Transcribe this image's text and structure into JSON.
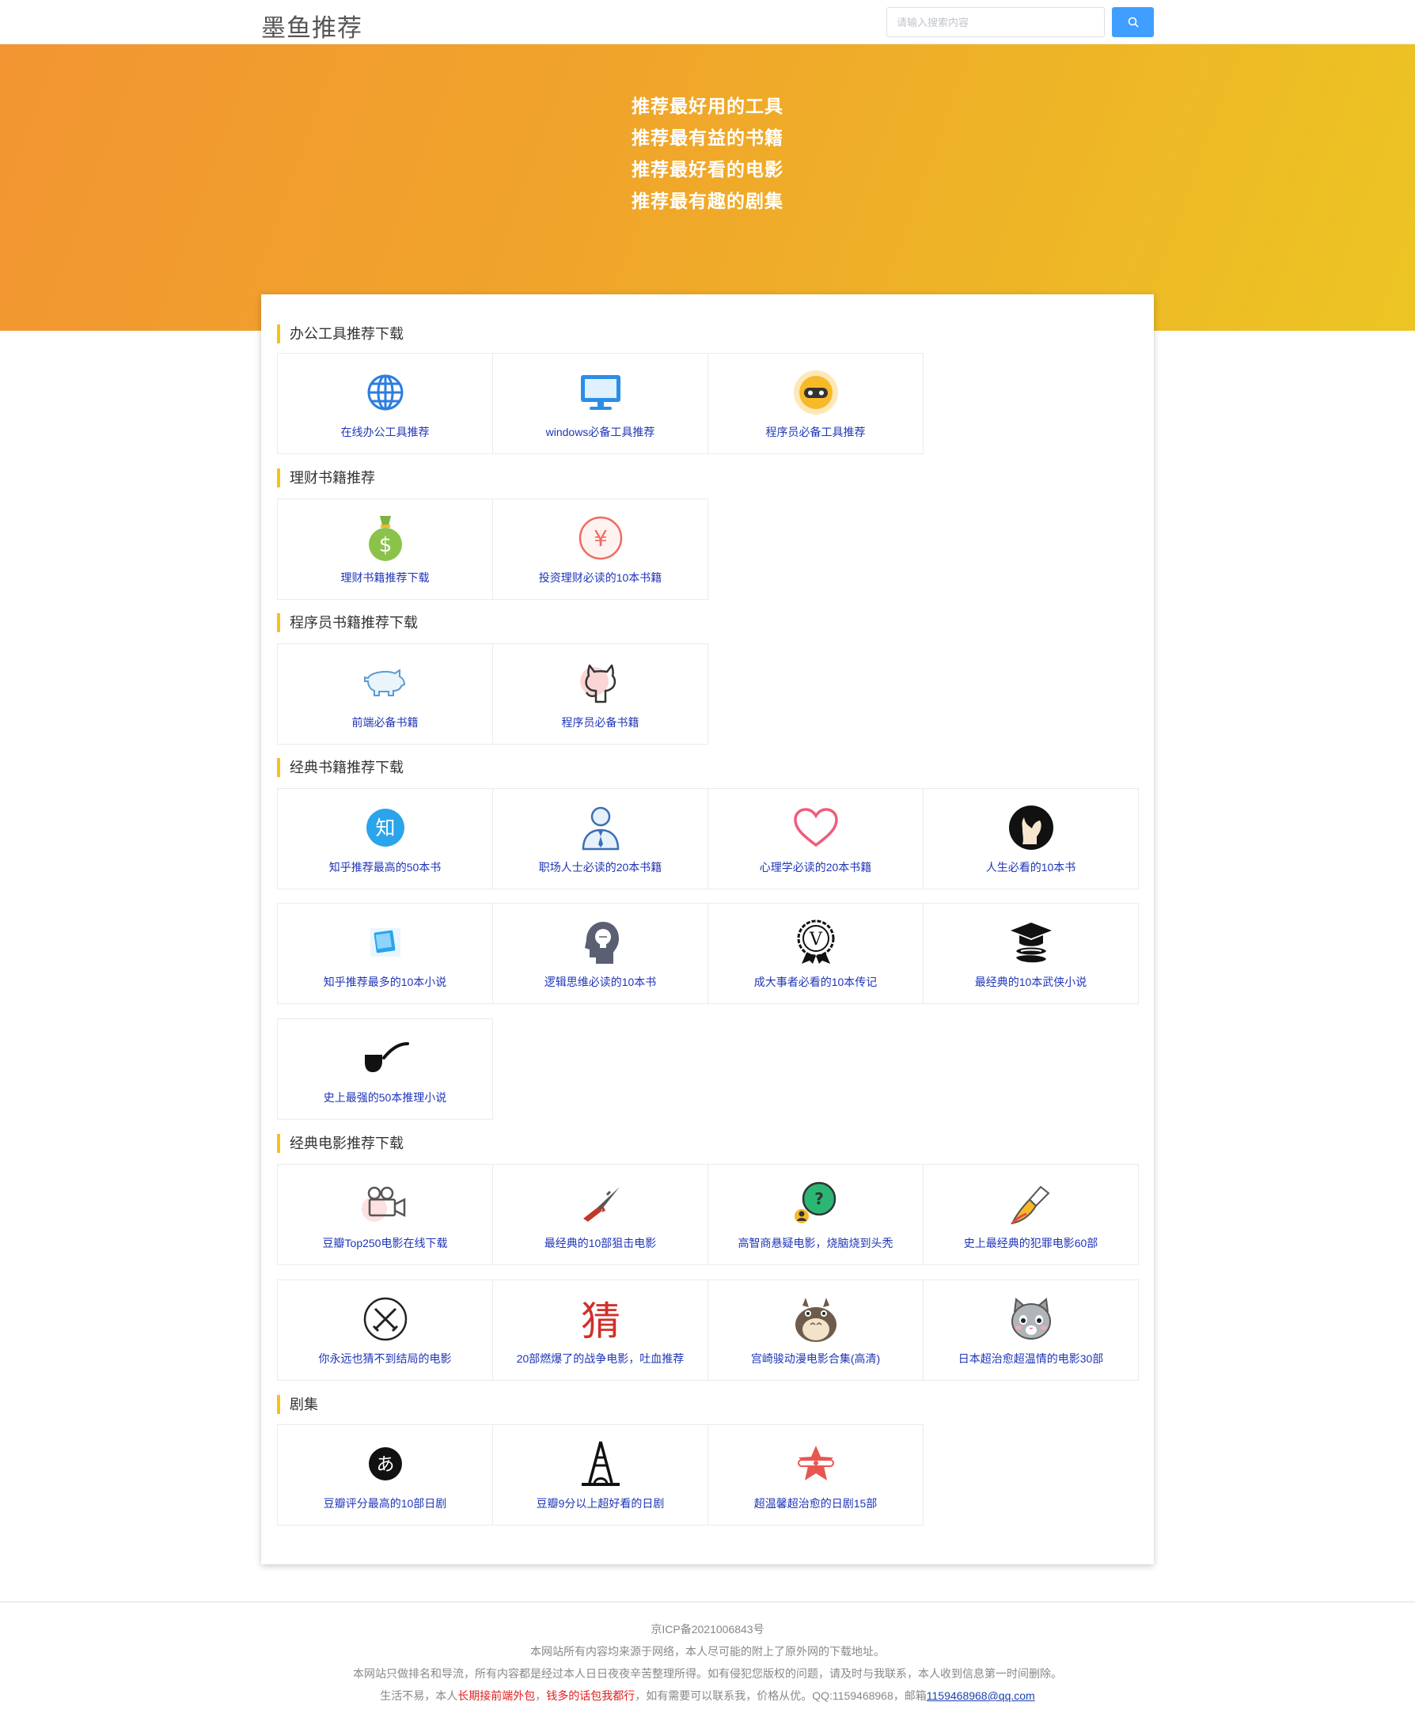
{
  "header": {
    "logo": "墨鱼推荐",
    "search_placeholder": "请输入搜索内容"
  },
  "banner": {
    "lines": [
      "推荐最好用的工具",
      "推荐最有益的书籍",
      "推荐最好看的电影",
      "推荐最有趣的剧集"
    ]
  },
  "sections": [
    {
      "title": "办公工具推荐下载",
      "items": [
        {
          "label": "在线办公工具推荐",
          "icon": "globe-icon"
        },
        {
          "label": "windows必备工具推荐",
          "icon": "monitor-icon"
        },
        {
          "label": "程序员必备工具推荐",
          "icon": "coder-face-icon"
        }
      ]
    },
    {
      "title": "理财书籍推荐",
      "items": [
        {
          "label": "理财书籍推荐下载",
          "icon": "money-bag-icon"
        },
        {
          "label": "投资理财必读的10本书籍",
          "icon": "yen-coin-icon"
        }
      ]
    },
    {
      "title": "程序员书籍推荐下载",
      "items": [
        {
          "label": "前端必备书籍",
          "icon": "pig-icon"
        },
        {
          "label": "程序员必备书籍",
          "icon": "github-cat-icon"
        }
      ]
    },
    {
      "title": "经典书籍推荐下载",
      "items": [
        {
          "label": "知乎推荐最高的50本书",
          "icon": "zhihu-icon",
          "glyph": "知"
        },
        {
          "label": "职场人士必读的20本书籍",
          "icon": "businessman-icon"
        },
        {
          "label": "心理学必读的20本书籍",
          "icon": "heart-icon"
        },
        {
          "label": "人生必看的10本书",
          "icon": "portrait-icon"
        },
        {
          "label": "知乎推荐最多的10本小说",
          "icon": "book-icon"
        },
        {
          "label": "逻辑思维必读的10本书",
          "icon": "head-bulb-icon"
        },
        {
          "label": "成大事者必看的10本传记",
          "icon": "v-badge-icon",
          "glyph": "V"
        },
        {
          "label": "最经典的10本武侠小说",
          "icon": "graduate-icon"
        },
        {
          "label": "史上最强的50本推理小说",
          "icon": "pipe-icon"
        }
      ]
    },
    {
      "title": "经典电影推荐下载",
      "items": [
        {
          "label": "豆瓣Top250电影在线下载",
          "icon": "movie-camera-icon"
        },
        {
          "label": "最经典的10部狙击电影",
          "icon": "rifle-icon"
        },
        {
          "label": "高智商悬疑电影，烧脑烧到头秃",
          "icon": "question-icon",
          "glyph": "?"
        },
        {
          "label": "史上最经典的犯罪电影60部",
          "icon": "knife-icon"
        },
        {
          "label": "你永远也猜不到结局的电影",
          "icon": "crossed-swords-icon"
        },
        {
          "label": "20部燃爆了的战争电影，吐血推荐",
          "icon": "guess-char-icon",
          "glyph": "猜"
        },
        {
          "label": "宫崎骏动漫电影合集(高清)",
          "icon": "totoro-icon"
        },
        {
          "label": "日本超治愈超温情的电影30部",
          "icon": "cat-icon"
        }
      ]
    },
    {
      "title": "剧集",
      "items": [
        {
          "label": "豆瓣评分最高的10部日剧",
          "icon": "hiragana-a-icon",
          "glyph": "あ"
        },
        {
          "label": "豆瓣9分以上超好看的日剧",
          "icon": "tower-icon"
        },
        {
          "label": "超温馨超治愈的日剧15部",
          "icon": "star-badge-icon"
        }
      ]
    }
  ],
  "footer": {
    "icp": "京ICP备2021006843号",
    "line2": "本网站所有内容均来源于网络，本人尽可能的附上了原外网的下载地址。",
    "line3": "本网站只做排名和导流，所有内容都是经过本人日日夜夜辛苦整理所得。如有侵犯您版权的问题，请及时与我联系，本人收到信息第一时间删除。",
    "line4_a": "生活不易，本人",
    "line4_red1": "长期接前端外包",
    "line4_b": "，",
    "line4_red2": "钱多的话包我都行",
    "line4_c": "，如有需要可以联系我，价格从优。QQ:1159468968，邮箱",
    "email": "1159468968@qq.com"
  }
}
